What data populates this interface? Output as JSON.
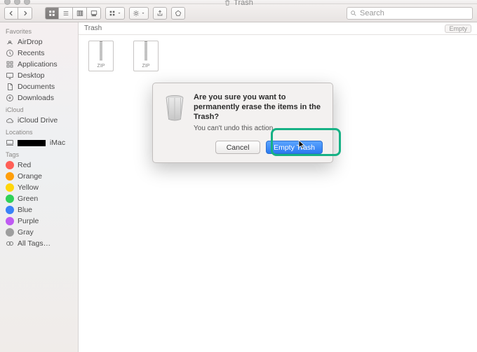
{
  "window": {
    "title": "Trash"
  },
  "toolbar": {
    "search_placeholder": "Search"
  },
  "pathbar": {
    "location": "Trash",
    "empty_label": "Empty"
  },
  "sidebar": {
    "sections": [
      {
        "header": "Favorites",
        "items": [
          {
            "label": "AirDrop",
            "icon": "airdrop"
          },
          {
            "label": "Recents",
            "icon": "recents"
          },
          {
            "label": "Applications",
            "icon": "apps"
          },
          {
            "label": "Desktop",
            "icon": "desktop"
          },
          {
            "label": "Documents",
            "icon": "documents"
          },
          {
            "label": "Downloads",
            "icon": "downloads"
          }
        ]
      },
      {
        "header": "iCloud",
        "items": [
          {
            "label": "iCloud Drive",
            "icon": "icloud"
          }
        ]
      },
      {
        "header": "Locations",
        "items": [
          {
            "label": "iMac",
            "icon": "computer",
            "redacted": true
          }
        ]
      },
      {
        "header": "Tags",
        "items": [
          {
            "label": "Red",
            "color": "#ff5f57"
          },
          {
            "label": "Orange",
            "color": "#ff9f0a"
          },
          {
            "label": "Yellow",
            "color": "#ffd60a"
          },
          {
            "label": "Green",
            "color": "#30d158"
          },
          {
            "label": "Blue",
            "color": "#3a82f7"
          },
          {
            "label": "Purple",
            "color": "#bf5af2"
          },
          {
            "label": "Gray",
            "color": "#9e9e9e"
          },
          {
            "label": "All Tags…",
            "icon": "alltags"
          }
        ]
      }
    ]
  },
  "files": [
    {
      "name": "",
      "type": "ZIP"
    },
    {
      "name": "",
      "type": "ZIP"
    }
  ],
  "dialog": {
    "title": "Are you sure you want to permanently erase the items in the Trash?",
    "subtitle": "You can't undo this action.",
    "cancel": "Cancel",
    "confirm": "Empty Trash"
  }
}
